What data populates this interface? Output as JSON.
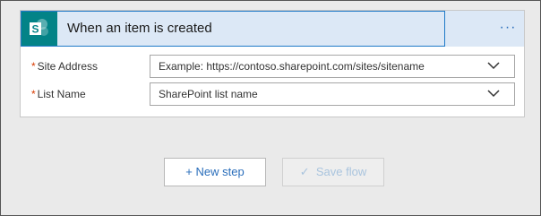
{
  "trigger": {
    "title": "When an item is created",
    "more_label": "···",
    "logo_icon": "sharepoint-icon",
    "logo_color": "#038387"
  },
  "fields": [
    {
      "label": "Site Address",
      "required_mark": "*",
      "placeholder": "Example: https://contoso.sharepoint.com/sites/sitename"
    },
    {
      "label": "List Name",
      "required_mark": "*",
      "placeholder": "SharePoint list name"
    }
  ],
  "actions": {
    "new_step": "+ New step",
    "save_flow_icon": "✓",
    "save_flow": "Save flow"
  },
  "colors": {
    "accent": "#2a6ebb",
    "header_bg": "#dce8f6",
    "required": "#d83b01"
  }
}
